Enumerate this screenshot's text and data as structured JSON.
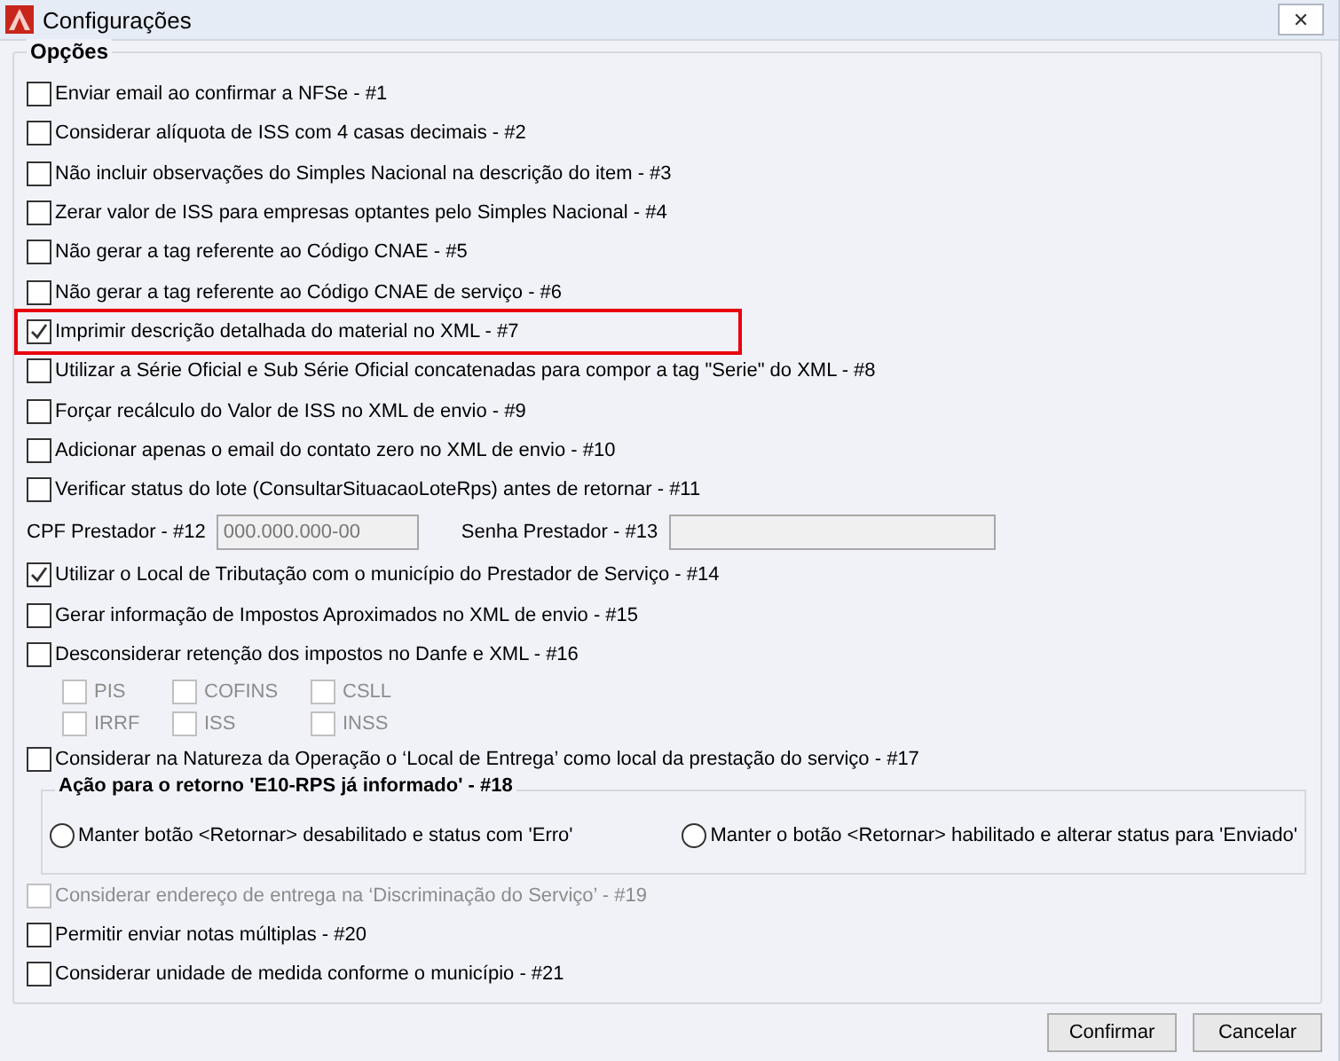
{
  "window": {
    "title": "Configurações",
    "close": "✕"
  },
  "group": {
    "title": "Opções"
  },
  "items": [
    {
      "kind": "checkbox",
      "label": "Enviar email ao confirmar a NFSe - #1",
      "checked": false,
      "disabled": false,
      "highlighted": false
    },
    {
      "kind": "checkbox",
      "label": "Considerar alíquota de ISS com 4 casas decimais  - #2",
      "checked": false,
      "disabled": false,
      "highlighted": false
    },
    {
      "kind": "checkbox",
      "label": "Não incluir observações do Simples Nacional na descrição do item - #3",
      "checked": false,
      "disabled": false,
      "highlighted": false
    },
    {
      "kind": "checkbox",
      "label": "Zerar valor de ISS para empresas optantes pelo Simples Nacional  - #4",
      "checked": false,
      "disabled": false,
      "highlighted": false
    },
    {
      "kind": "checkbox",
      "label": "Não gerar a tag referente ao Código CNAE - #5",
      "checked": false,
      "disabled": false,
      "highlighted": false
    },
    {
      "kind": "checkbox",
      "label": "Não gerar a tag referente ao Código CNAE de serviço - #6",
      "checked": false,
      "disabled": false,
      "highlighted": false
    },
    {
      "kind": "checkbox",
      "label": "Imprimir descrição detalhada do material no XML - #7",
      "checked": true,
      "disabled": false,
      "highlighted": true
    },
    {
      "kind": "checkbox",
      "label": "Utilizar a Série Oficial e Sub Série Oficial concatenadas para compor a tag \"Serie\" do XML - #8",
      "checked": false,
      "disabled": false,
      "highlighted": false
    },
    {
      "kind": "checkbox",
      "label": "Forçar recálculo do Valor de ISS no XML de envio - #9",
      "checked": false,
      "disabled": false,
      "highlighted": false
    },
    {
      "kind": "checkbox",
      "label": "Adicionar apenas o email do contato zero no XML de envio - #10",
      "checked": false,
      "disabled": false,
      "highlighted": false
    },
    {
      "kind": "checkbox",
      "label": "Verificar status do lote (ConsultarSituacaoLoteRps) antes de retornar - #11",
      "checked": false,
      "disabled": false,
      "highlighted": false
    },
    {
      "kind": "fields",
      "fields": [
        {
          "label": "CPF Prestador - #12",
          "value": "000.000.000-00",
          "disabled": true
        },
        {
          "label": "Senha Prestador - #13",
          "disabled": true
        }
      ]
    },
    {
      "kind": "checkbox",
      "label": "Utilizar o Local de Tributação com o município do Prestador de Serviço - #14",
      "checked": true,
      "disabled": false,
      "highlighted": false
    },
    {
      "kind": "checkbox",
      "label": "Gerar informação de Impostos Aproximados no XML de envio - #15",
      "checked": false,
      "disabled": false,
      "highlighted": false
    },
    {
      "kind": "checkbox",
      "label": "Desconsiderar retenção dos impostos no Danfe e XML - #16",
      "checked": false,
      "disabled": false,
      "highlighted": false
    },
    {
      "kind": "subchecks",
      "options": [
        {
          "label": "PIS",
          "checked": false,
          "disabled": true
        },
        {
          "label": "COFINS",
          "checked": false,
          "disabled": true
        },
        {
          "label": "CSLL",
          "checked": false,
          "disabled": true
        },
        {
          "label": "IRRF",
          "checked": false,
          "disabled": true
        },
        {
          "label": "ISS",
          "checked": false,
          "disabled": true
        },
        {
          "label": "INSS",
          "checked": false,
          "disabled": true
        }
      ]
    },
    {
      "kind": "checkbox",
      "label": "Considerar na Natureza da Operação o ‘Local de Entrega’ como local da prestação do serviço - #17",
      "checked": false,
      "disabled": false,
      "highlighted": false
    },
    {
      "kind": "radio_group",
      "title": "Ação para o retorno 'E10-RPS já informado' - #18",
      "options": [
        {
          "label": "Manter botão <Retornar> desabilitado e status com 'Erro'",
          "selected": false
        },
        {
          "label": "Manter o botão <Retornar> habilitado e alterar status para 'Enviado'",
          "selected": false
        }
      ]
    },
    {
      "kind": "checkbox",
      "label": "Considerar endereço de entrega na ‘Discriminação do Serviço’ - #19",
      "checked": false,
      "disabled": true,
      "highlighted": false
    },
    {
      "kind": "checkbox",
      "label": "Permitir enviar notas múltiplas - #20",
      "checked": false,
      "disabled": false,
      "highlighted": false
    },
    {
      "kind": "checkbox",
      "label": "Considerar unidade de medida conforme o município - #21",
      "checked": false,
      "disabled": false,
      "highlighted": false
    }
  ],
  "buttons": [
    "Confirmar",
    "Cancelar"
  ]
}
